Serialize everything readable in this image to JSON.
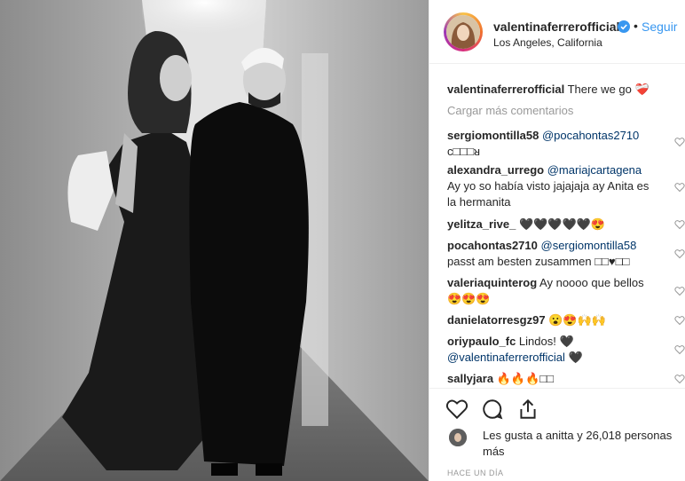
{
  "post": {
    "image_alt": "black and white photo of a couple walking down a hallway",
    "author": {
      "username": "valentinaferrerofficial",
      "verified": true,
      "location": "Los Angeles, California",
      "follow_label": "Seguir",
      "separator": "•"
    },
    "caption": {
      "username": "valentinaferrerofficial",
      "text": "There we go ❤️‍🩹"
    },
    "load_more_label": "Cargar más comentarios",
    "comments": [
      {
        "user": "sergiomontilla58",
        "mention": "@pocahontas2710",
        "text": "",
        "line2": "c□□□ᴚ"
      },
      {
        "user": "alexandra_urrego",
        "mention": "@mariajcartagena",
        "text": "",
        "line2": "Ay yo so había visto jajajaja ay Anita es la hermanita"
      },
      {
        "user": "yelitza_rive_",
        "mention": "",
        "text": "🖤🖤🖤🖤🖤😍",
        "line2": ""
      },
      {
        "user": "pocahontas2710",
        "mention": "@sergiomontilla58",
        "text": "",
        "line2": "passt am besten zusammen □□♥□□"
      },
      {
        "user": "valeriaquinterog",
        "mention": "",
        "text": "Ay noooo que bellos",
        "line2": "😍😍😍"
      },
      {
        "user": "danielatorresgz97",
        "mention": "",
        "text": "😮😍🙌🙌",
        "line2": ""
      },
      {
        "user": "oriypaulo_fc",
        "mention": "",
        "text": "Lindos! 🖤",
        "line2": "@valentinaferrerofficial 🖤"
      },
      {
        "user": "sallyjara",
        "mention": "",
        "text": "🔥🔥🔥□□",
        "line2": ""
      }
    ],
    "likes_text": "Les gusta a anitta y 26,018 personas más",
    "timestamp": "HACE UN DÍA",
    "icons": [
      "heart-icon",
      "comment-icon",
      "share-icon"
    ]
  }
}
